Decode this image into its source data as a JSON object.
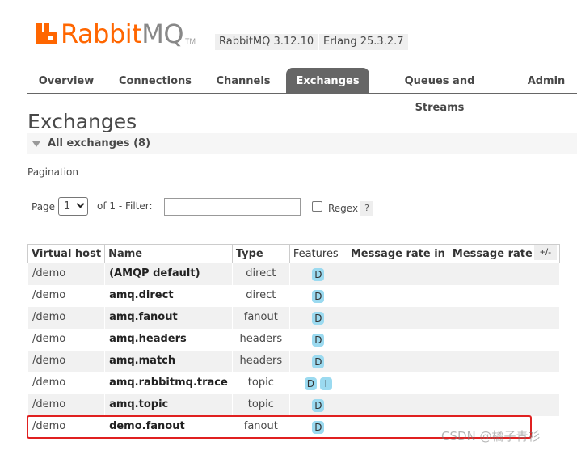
{
  "brand": {
    "name_primary": "Rabbit",
    "name_secondary": "MQ",
    "trademark": "TM",
    "version": "RabbitMQ 3.12.10",
    "erlang": "Erlang 25.3.2.7"
  },
  "tabs": [
    {
      "label": "Overview"
    },
    {
      "label": "Connections"
    },
    {
      "label": "Channels"
    },
    {
      "label": "Exchanges",
      "active": true
    },
    {
      "label": "Queues and Streams"
    },
    {
      "label": "Admin"
    }
  ],
  "page": {
    "title": "Exchanges",
    "section_label": "All exchanges (8)",
    "pagination_label": "Pagination"
  },
  "pagination": {
    "page_label": "Page",
    "page_value": "1",
    "of_label": "of 1  - Filter:",
    "filter_value": "",
    "regex_label": "Regex",
    "help_label": "?"
  },
  "table": {
    "columns": [
      "Virtual host",
      "Name",
      "Type",
      "Features",
      "Message rate in",
      "Message rate out"
    ],
    "toggle_label": "+/-",
    "rows": [
      {
        "vhost": "/demo",
        "name": "(AMQP default)",
        "type": "direct",
        "features": [
          "D"
        ],
        "rate_in": "",
        "rate_out": ""
      },
      {
        "vhost": "/demo",
        "name": "amq.direct",
        "type": "direct",
        "features": [
          "D"
        ],
        "rate_in": "",
        "rate_out": ""
      },
      {
        "vhost": "/demo",
        "name": "amq.fanout",
        "type": "fanout",
        "features": [
          "D"
        ],
        "rate_in": "",
        "rate_out": ""
      },
      {
        "vhost": "/demo",
        "name": "amq.headers",
        "type": "headers",
        "features": [
          "D"
        ],
        "rate_in": "",
        "rate_out": ""
      },
      {
        "vhost": "/demo",
        "name": "amq.match",
        "type": "headers",
        "features": [
          "D"
        ],
        "rate_in": "",
        "rate_out": ""
      },
      {
        "vhost": "/demo",
        "name": "amq.rabbitmq.trace",
        "type": "topic",
        "features": [
          "D",
          "I"
        ],
        "rate_in": "",
        "rate_out": ""
      },
      {
        "vhost": "/demo",
        "name": "amq.topic",
        "type": "topic",
        "features": [
          "D"
        ],
        "rate_in": "",
        "rate_out": ""
      },
      {
        "vhost": "/demo",
        "name": "demo.fanout",
        "type": "fanout",
        "features": [
          "D"
        ],
        "rate_in": "",
        "rate_out": "",
        "highlighted": true
      }
    ]
  },
  "watermark": "CSDN @橘子青衫",
  "colors": {
    "brand_orange": "#ff6600",
    "tab_active": "#666666",
    "feature_badge": "#9bdaf0",
    "highlight_border": "#e02020"
  }
}
